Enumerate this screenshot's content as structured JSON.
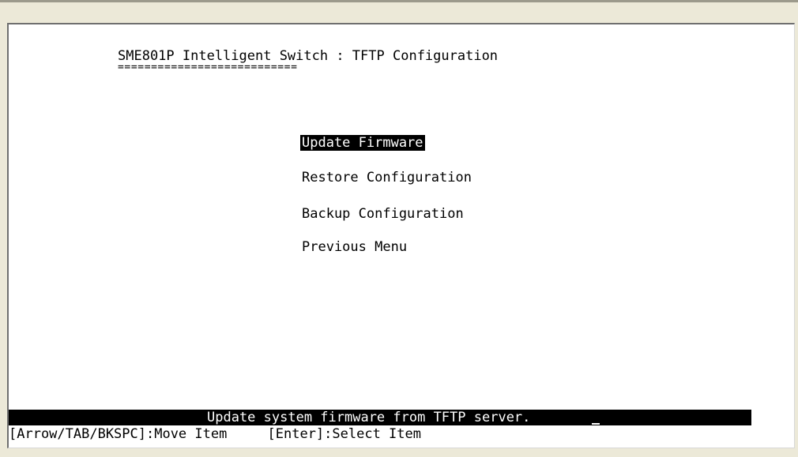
{
  "screen": {
    "title": "SME801P Intelligent Switch : TFTP Configuration",
    "title_underline": "==========================="
  },
  "menu": {
    "items": [
      {
        "label": "Update Firmware",
        "selected": true
      },
      {
        "label": "Restore Configuration",
        "selected": false
      },
      {
        "label": "Backup Configuration",
        "selected": false
      },
      {
        "label": "Previous Menu",
        "selected": false
      }
    ]
  },
  "status": {
    "message": "Update system firmware from TFTP server."
  },
  "help": {
    "text": "[Arrow/TAB/BKSPC]:Move Item     [Enter]:Select Item"
  },
  "colors": {
    "background": "#ffffff",
    "text": "#000000",
    "highlight_bg": "#000000",
    "highlight_text": "#ffffff",
    "window_chrome": "#ece9d8"
  }
}
